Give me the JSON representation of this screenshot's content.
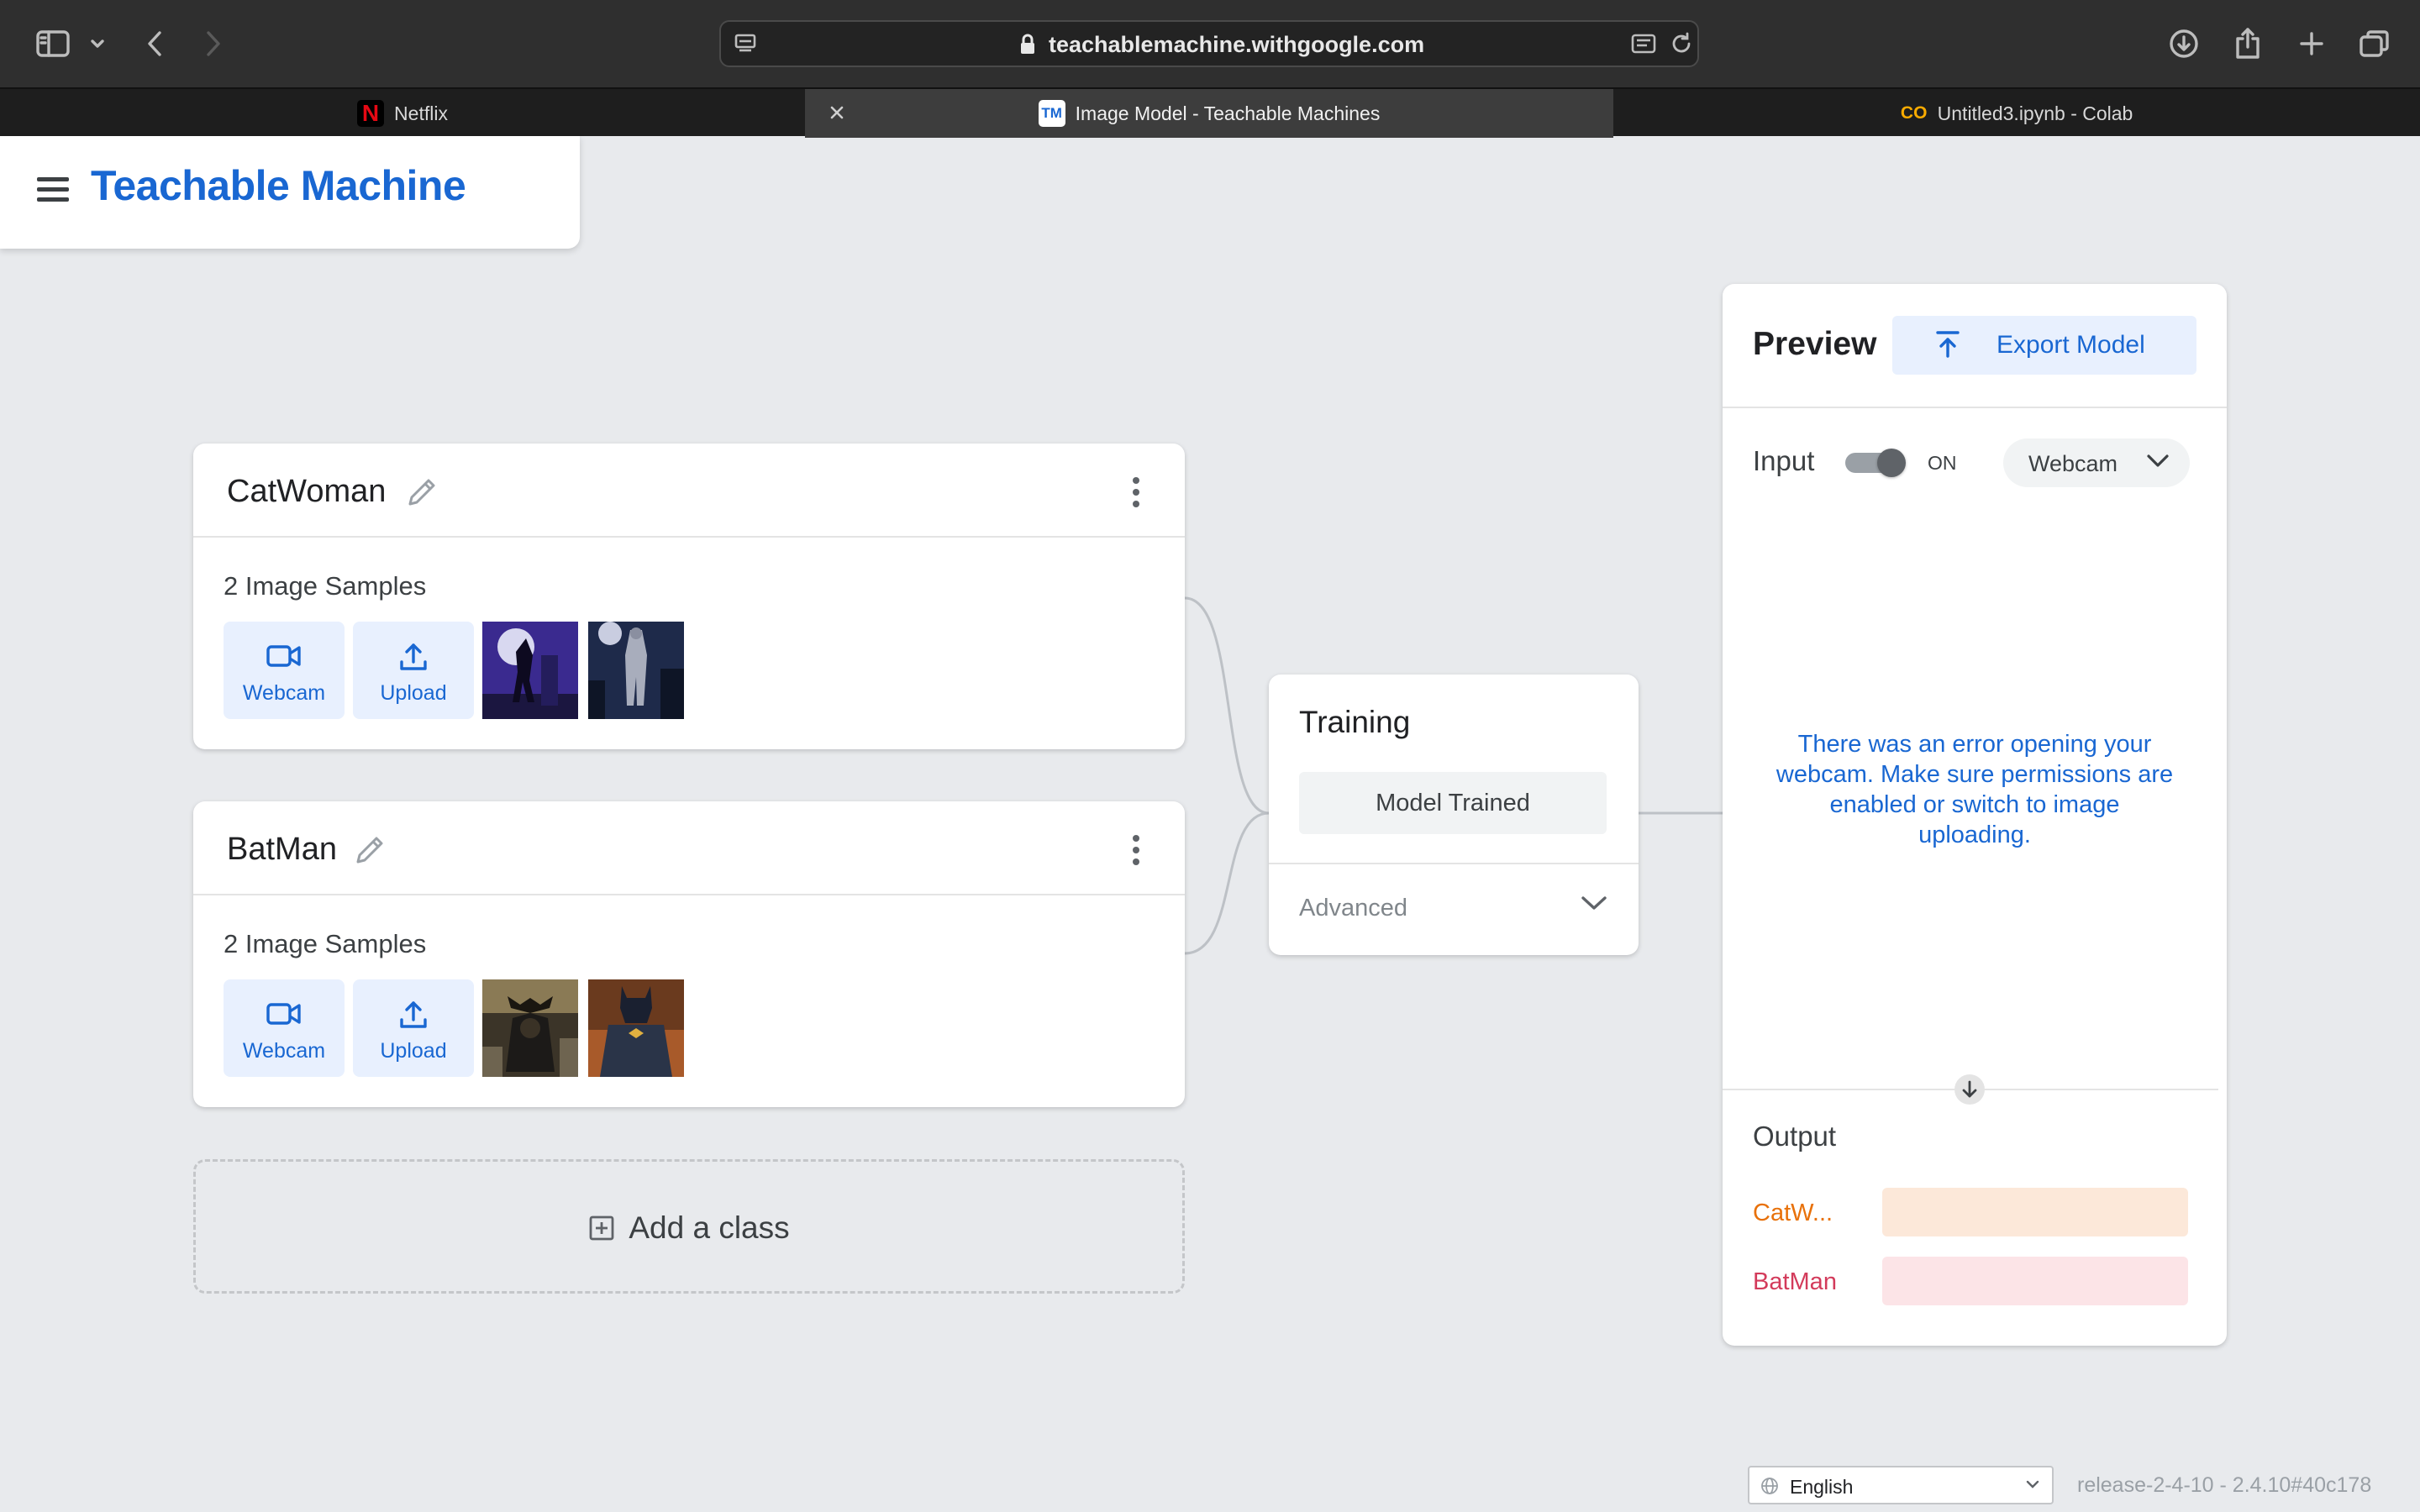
{
  "browser": {
    "url": "teachablemachine.withgoogle.com",
    "tabs": [
      {
        "title": "Netflix",
        "favicon": "N",
        "active": false
      },
      {
        "title": "Image Model - Teachable Machines",
        "favicon": "TM",
        "active": true
      },
      {
        "title": "Untitled3.ipynb - Colab",
        "favicon": "CO",
        "active": false
      }
    ]
  },
  "app": {
    "title": "Teachable Machine"
  },
  "classes": [
    {
      "name": "CatWoman",
      "samples_label": "2 Image Samples",
      "webcam_label": "Webcam",
      "upload_label": "Upload"
    },
    {
      "name": "BatMan",
      "samples_label": "2 Image Samples",
      "webcam_label": "Webcam",
      "upload_label": "Upload"
    }
  ],
  "add_class_label": "Add a class",
  "training": {
    "title": "Training",
    "button_label": "Model Trained",
    "advanced_label": "Advanced"
  },
  "preview": {
    "title": "Preview",
    "export_label": "Export Model",
    "input_label": "Input",
    "toggle_state": "ON",
    "source": "Webcam",
    "error_message": "There was an error opening your webcam. Make sure permissions are enabled or switch to image uploading.",
    "output_label": "Output",
    "outputs": [
      {
        "name": "CatW...",
        "color": "#e8710a",
        "bar_color": "#fce8d9",
        "confidence": 0
      },
      {
        "name": "BatMan",
        "color": "#d33b5b",
        "bar_color": "#fce4e7",
        "confidence": 0
      }
    ]
  },
  "footer": {
    "language": "English",
    "release": "release-2-4-10 - 2.4.10#40c178"
  },
  "colors": {
    "accent": "#1967d2",
    "accent_bg": "#e8f0fe",
    "page_bg": "#e8eaed"
  }
}
